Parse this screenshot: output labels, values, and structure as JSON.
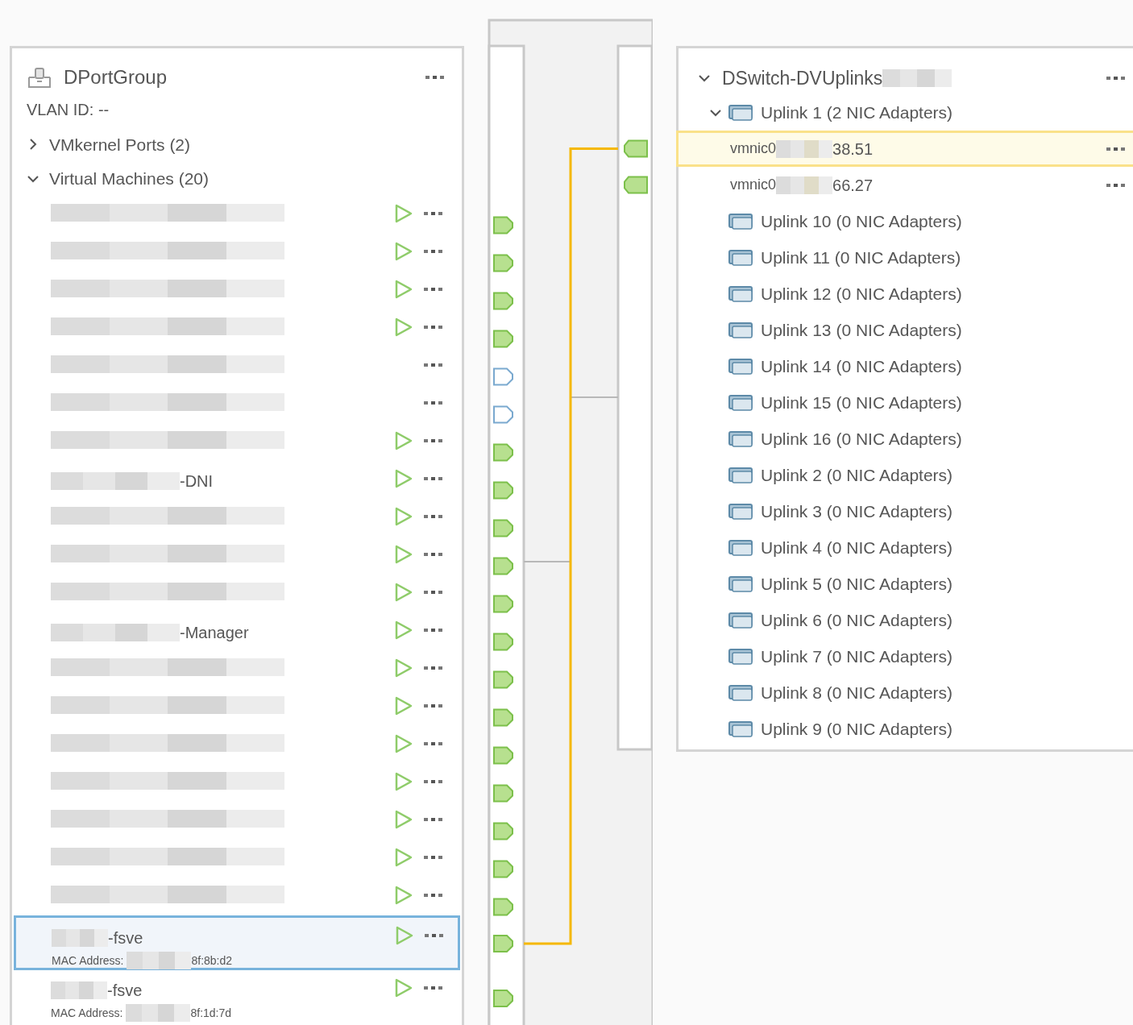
{
  "portgroup": {
    "title": "DPortGroup",
    "vlan": "VLAN ID: --",
    "sections": [
      {
        "label": "VMkernel Ports (2)",
        "expanded": false
      },
      {
        "label": "Virtual Machines (20)",
        "expanded": true
      }
    ],
    "vms": [
      {
        "powered_on": true,
        "port_connected": true,
        "selected": false
      },
      {
        "powered_on": true,
        "port_connected": true,
        "selected": false
      },
      {
        "powered_on": true,
        "port_connected": true,
        "selected": false
      },
      {
        "powered_on": true,
        "port_connected": true,
        "selected": false
      },
      {
        "powered_on": false,
        "port_connected": false,
        "selected": false
      },
      {
        "powered_on": false,
        "port_connected": false,
        "selected": false
      },
      {
        "powered_on": true,
        "port_connected": true,
        "selected": false
      },
      {
        "name": "-DNI",
        "powered_on": true,
        "port_connected": true,
        "selected": false
      },
      {
        "powered_on": true,
        "port_connected": true,
        "selected": false
      },
      {
        "powered_on": true,
        "port_connected": true,
        "selected": false
      },
      {
        "powered_on": true,
        "port_connected": true,
        "selected": false
      },
      {
        "name": "-Manager",
        "powered_on": true,
        "port_connected": true,
        "selected": false
      },
      {
        "powered_on": true,
        "port_connected": true,
        "selected": false
      },
      {
        "powered_on": true,
        "port_connected": true,
        "selected": false
      },
      {
        "powered_on": true,
        "port_connected": true,
        "selected": false
      },
      {
        "powered_on": true,
        "port_connected": true,
        "selected": false
      },
      {
        "powered_on": true,
        "port_connected": true,
        "selected": false
      },
      {
        "powered_on": true,
        "port_connected": true,
        "selected": false
      },
      {
        "powered_on": true,
        "port_connected": true,
        "selected": false
      },
      {
        "name": "-fsve",
        "mac_label": "MAC Address:",
        "mac": "8f:8b:d2",
        "powered_on": true,
        "port_connected": true,
        "selected": true
      },
      {
        "name": "-fsve",
        "mac_label": "MAC Address:",
        "mac": "8f:1d:7d",
        "powered_on": true,
        "port_connected": true,
        "selected": false
      }
    ]
  },
  "uplinks": {
    "title": "DSwitch-DVUplinks",
    "expanded": true,
    "items": [
      {
        "label": "Uplink 1 (2 NIC Adapters)",
        "expanded": true,
        "nics": [
          {
            "name": "vmnic0",
            "address": "38.51",
            "selected": true
          },
          {
            "name": "vmnic0",
            "address": "66.27",
            "selected": false
          }
        ]
      },
      {
        "label": "Uplink 10 (0 NIC Adapters)"
      },
      {
        "label": "Uplink 11 (0 NIC Adapters)"
      },
      {
        "label": "Uplink 12 (0 NIC Adapters)"
      },
      {
        "label": "Uplink 13 (0 NIC Adapters)"
      },
      {
        "label": "Uplink 14 (0 NIC Adapters)"
      },
      {
        "label": "Uplink 15 (0 NIC Adapters)"
      },
      {
        "label": "Uplink 16 (0 NIC Adapters)"
      },
      {
        "label": "Uplink 2 (0 NIC Adapters)"
      },
      {
        "label": "Uplink 3 (0 NIC Adapters)"
      },
      {
        "label": "Uplink 4 (0 NIC Adapters)"
      },
      {
        "label": "Uplink 5 (0 NIC Adapters)"
      },
      {
        "label": "Uplink 6 (0 NIC Adapters)"
      },
      {
        "label": "Uplink 7 (0 NIC Adapters)"
      },
      {
        "label": "Uplink 8 (0 NIC Adapters)"
      },
      {
        "label": "Uplink 9 (0 NIC Adapters)"
      }
    ]
  }
}
